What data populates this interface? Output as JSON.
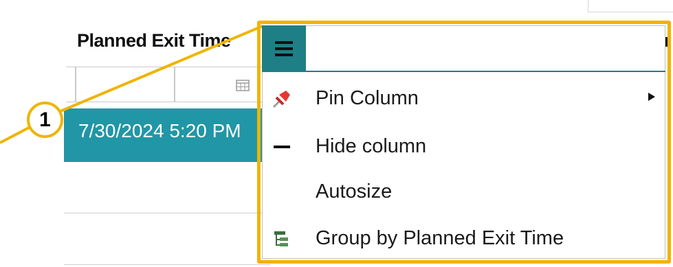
{
  "grid": {
    "column_header": "Planned Exit Time",
    "column_header_right": "r",
    "row_value": "7/30/2024 5:20 PM"
  },
  "callout": {
    "number": "1"
  },
  "column_menu": {
    "tab_icon": "hamburger-icon",
    "items": [
      {
        "label": "Pin Column",
        "icon": "pin-icon",
        "submenu": true
      },
      {
        "label": "Hide column",
        "icon": "minus-icon",
        "submenu": false
      },
      {
        "label": "Autosize",
        "icon": "",
        "submenu": false
      },
      {
        "label": "Group by Planned Exit Time",
        "icon": "tree-icon",
        "submenu": false
      }
    ]
  },
  "colors": {
    "accent": "#2196a6",
    "menu_tab": "#1f7f87",
    "highlight": "#f0b400",
    "pin": "#e53935"
  }
}
